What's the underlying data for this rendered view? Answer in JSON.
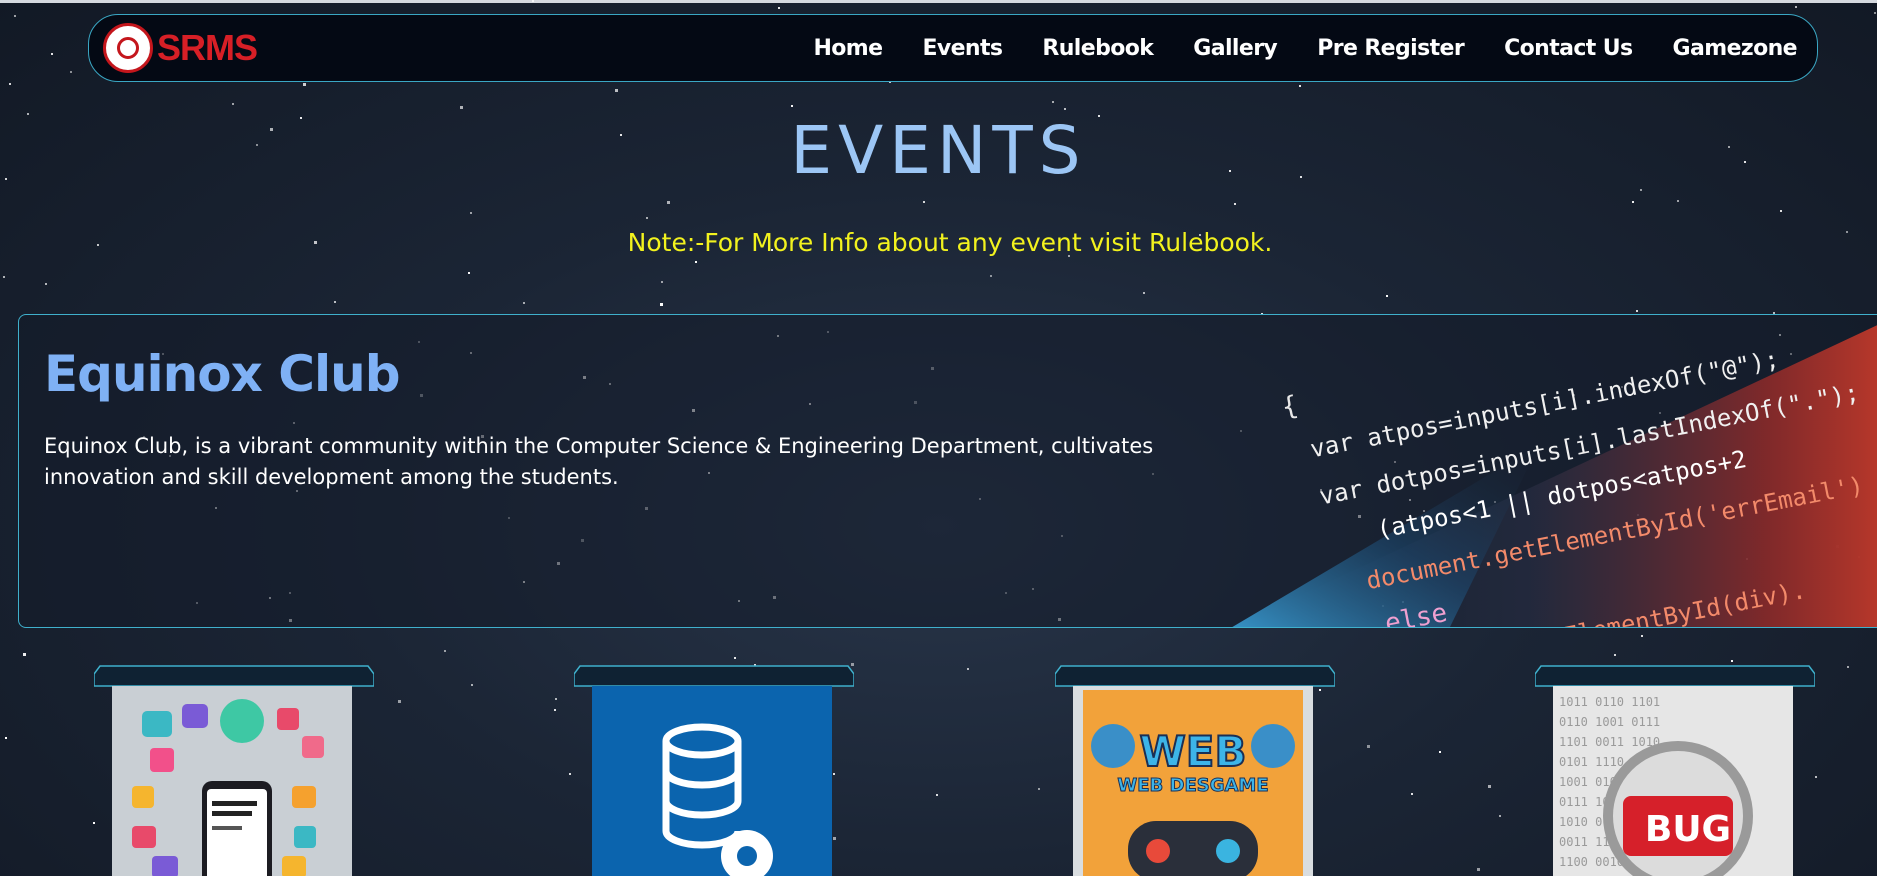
{
  "brand": {
    "logo_text": "SRMS",
    "logo_icon": "srms-seal-icon",
    "brand_color": "#d71f26"
  },
  "nav": {
    "items": [
      {
        "label": "Home"
      },
      {
        "label": "Events"
      },
      {
        "label": "Rulebook"
      },
      {
        "label": "Gallery"
      },
      {
        "label": "Pre Register"
      },
      {
        "label": "Contact Us"
      },
      {
        "label": "Gamezone"
      }
    ]
  },
  "page": {
    "heading": "EVENTS",
    "note": "Note:-For More Info about any event visit Rulebook."
  },
  "club": {
    "title": "Equinox Club",
    "description": "Equinox Club, is a vibrant community within the Computer Science & Engineering Department, cultivates innovation and skill development among the students.",
    "code_lines": [
      "{",
      "var atpos=inputs[i].indexOf(\"@\");",
      "var dotpos=inputs[i].lastIndexOf(\".\");",
      "(atpos<1 || dotpos<atpos+2",
      "document.getElementById('errEmail')",
      "else",
      "document.getElementById(div)."
    ]
  },
  "events": [
    {
      "poster_icon": "app-design-poster",
      "poster_bg": "#c9cfd4"
    },
    {
      "poster_icon": "database-gear-poster",
      "poster_bg": "#0b64ae"
    },
    {
      "poster_icon": "web-desgame-poster",
      "poster_bg": "#f2a23a",
      "poster_text_1": "WEB",
      "poster_text_2": "WEB DESGAME"
    },
    {
      "poster_icon": "bug-hunt-poster",
      "poster_bg": "#e6e6e6",
      "poster_text": "BUG"
    }
  ],
  "colors": {
    "accent": "#3fb0cc",
    "heading": "#9cc6f5",
    "note": "#f2f21e",
    "club_title": "#7fb1f5"
  }
}
